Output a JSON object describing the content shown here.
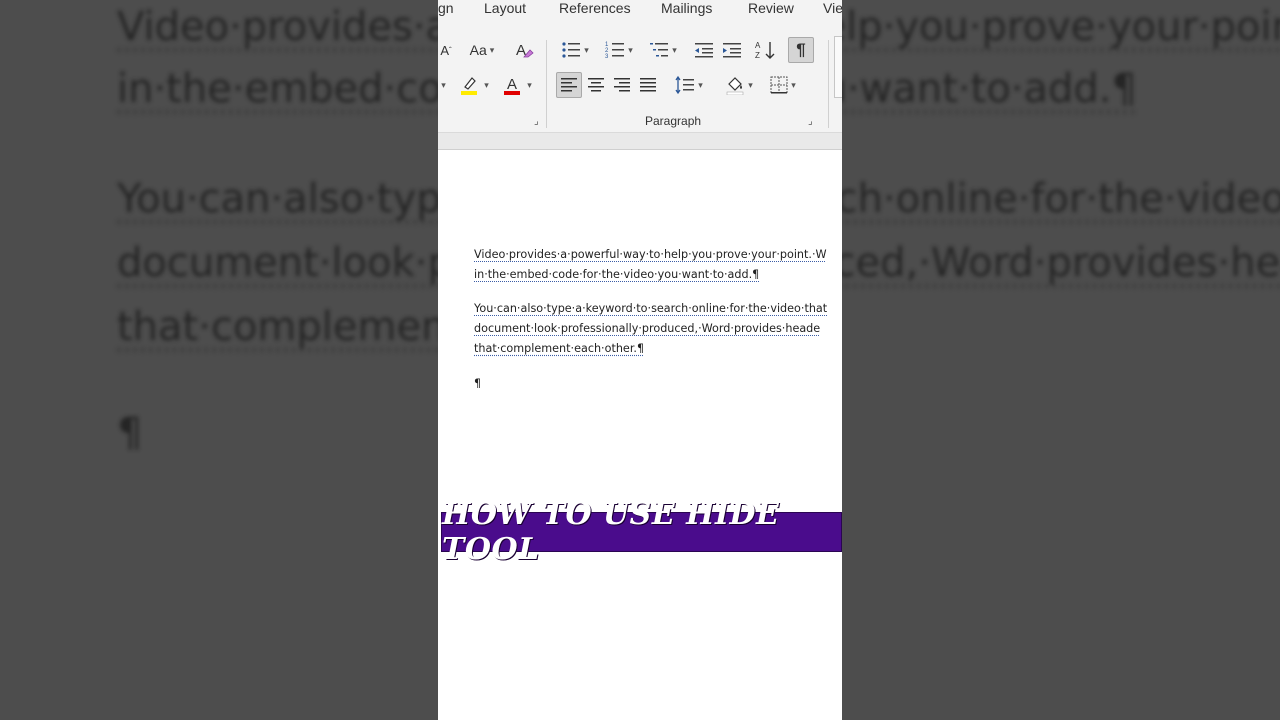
{
  "background": {
    "lines": [
      "Video·provides·a·powerful·way·to·help·you·prove·your·point.·W",
      "in·the·embed·code·for·the·video·you·want·to·add.¶",
      "You·can·also·type·a·keyword·to·search·online·for·the·video·that",
      "document·look·professionally·produced,·Word·provides·heade",
      "that·complement·each·other.¶",
      "¶"
    ]
  },
  "ribbon": {
    "tabs": [
      "gn",
      "Layout",
      "References",
      "Mailings",
      "Review",
      "Vie"
    ],
    "font_group": {
      "grow_font": "A",
      "change_case": "Aa",
      "highlight_color": "#ffeb00",
      "font_color": "#e00000",
      "font_color_letter": "A"
    },
    "paragraph_label": "Paragraph",
    "show_hide_symbol": "¶"
  },
  "document": {
    "paragraph1": [
      "Video·provides·a·powerful·way·to·help·you·prove·your·point.·W",
      "in·the·embed·code·for·the·video·you·want·to·add.¶"
    ],
    "paragraph2": [
      "You·can·also·type·a·keyword·to·search·online·for·the·video·that",
      "document·look·professionally·produced,·Word·provides·heade",
      "that·complement·each·other.¶"
    ],
    "empty_paragraph": "¶"
  },
  "banner": {
    "text": "HOW TO USE HIDE TOOL",
    "color": "#4a0c8c"
  }
}
